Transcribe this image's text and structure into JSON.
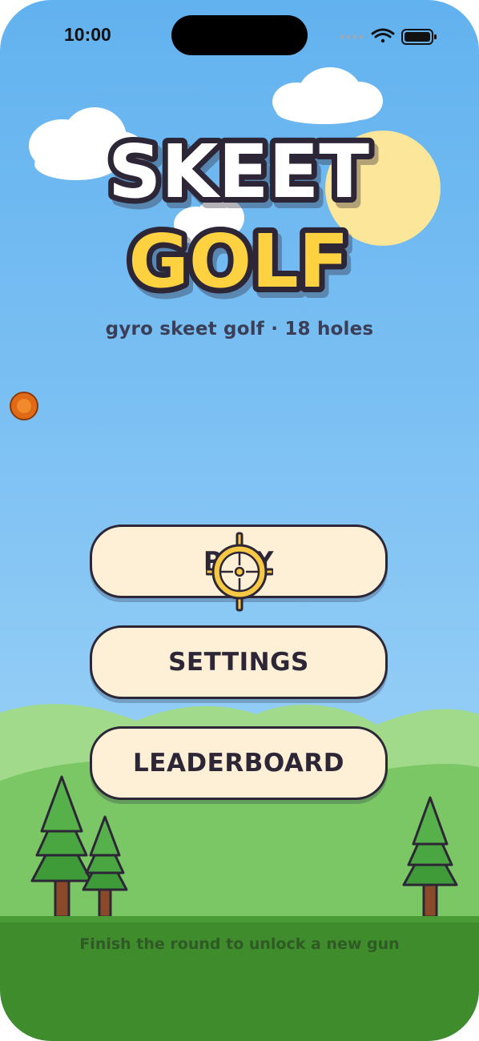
{
  "status_bar": {
    "time": "10:00",
    "icons": [
      "signal-dots-icon",
      "wifi-icon",
      "battery-icon"
    ]
  },
  "game": {
    "title_line1": "SKEET",
    "title_line2": "GOLF",
    "subtitle": "gyro skeet golf · 18 holes",
    "footer_hint": "Finish the round to unlock a new gun"
  },
  "menu": {
    "play_label": "PLAY",
    "settings_label": "SETTINGS",
    "leaderboard_label": "LEADERBOARD"
  },
  "colors": {
    "sky_top": "#62b2ef",
    "sky_bottom": "#a5d8f7",
    "title_white": "#ffffff",
    "title_yellow": "#fdd13f",
    "outline": "#2c2637",
    "button_fill": "#fdf0d6",
    "sun": "#fbe699",
    "grass": "#7cc765",
    "ground": "#3e8c2c",
    "clay_target": "#e06a16",
    "crosshair": "#f7c844"
  }
}
